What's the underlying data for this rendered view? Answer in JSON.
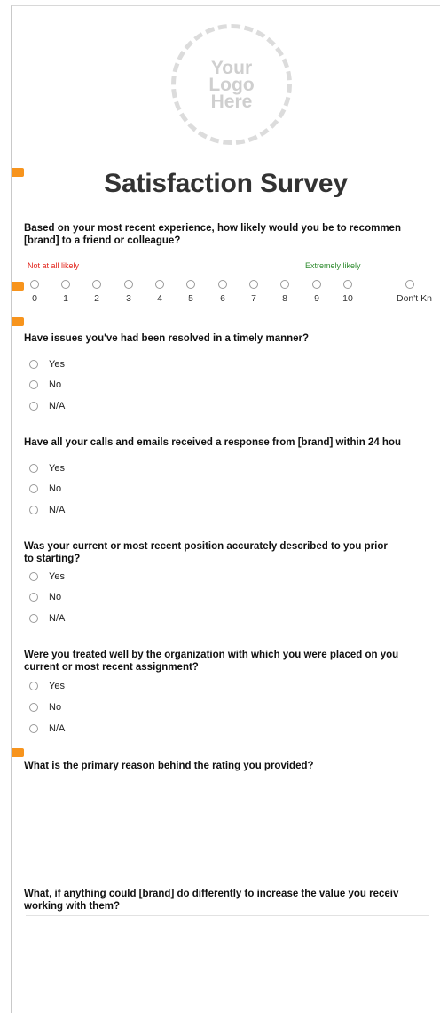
{
  "logo": {
    "line1": "Your",
    "line2": "Logo",
    "line3": "Here"
  },
  "title": "Satisfaction Survey",
  "q1": {
    "line1": "Based on your most recent experience, how likely would you be to recommen",
    "line2": "[brand] to a friend or colleague?",
    "low_label": "Not at all likely",
    "high_label": "Extremely likely",
    "scale": [
      "0",
      "1",
      "2",
      "3",
      "4",
      "5",
      "6",
      "7",
      "8",
      "9",
      "10",
      "Don't Kn"
    ]
  },
  "q2": {
    "text": "Have issues you've had been resolved in a timely manner?",
    "options": [
      "Yes",
      "No",
      "N/A"
    ]
  },
  "q3": {
    "text": "Have all your calls and emails received a response from [brand] within 24 hou",
    "options": [
      "Yes",
      "No",
      "N/A"
    ]
  },
  "q4": {
    "line1": "Was your current or most recent position accurately described to you prior",
    "line2": "to starting?",
    "options": [
      "Yes",
      "No",
      "N/A"
    ]
  },
  "q5": {
    "line1": "Were you treated well by the organization with which you were placed on you",
    "line2": "current or most recent assignment?",
    "options": [
      "Yes",
      "No",
      "N/A"
    ]
  },
  "q6": {
    "text": "What is the primary reason behind the rating you provided?"
  },
  "q7": {
    "line1": "What, if anything could [brand] do differently to increase the value you receiv",
    "line2": "working with them?"
  },
  "colors": {
    "accent": "#f7941d",
    "low": "#e2231a",
    "high": "#2e8b2e"
  }
}
